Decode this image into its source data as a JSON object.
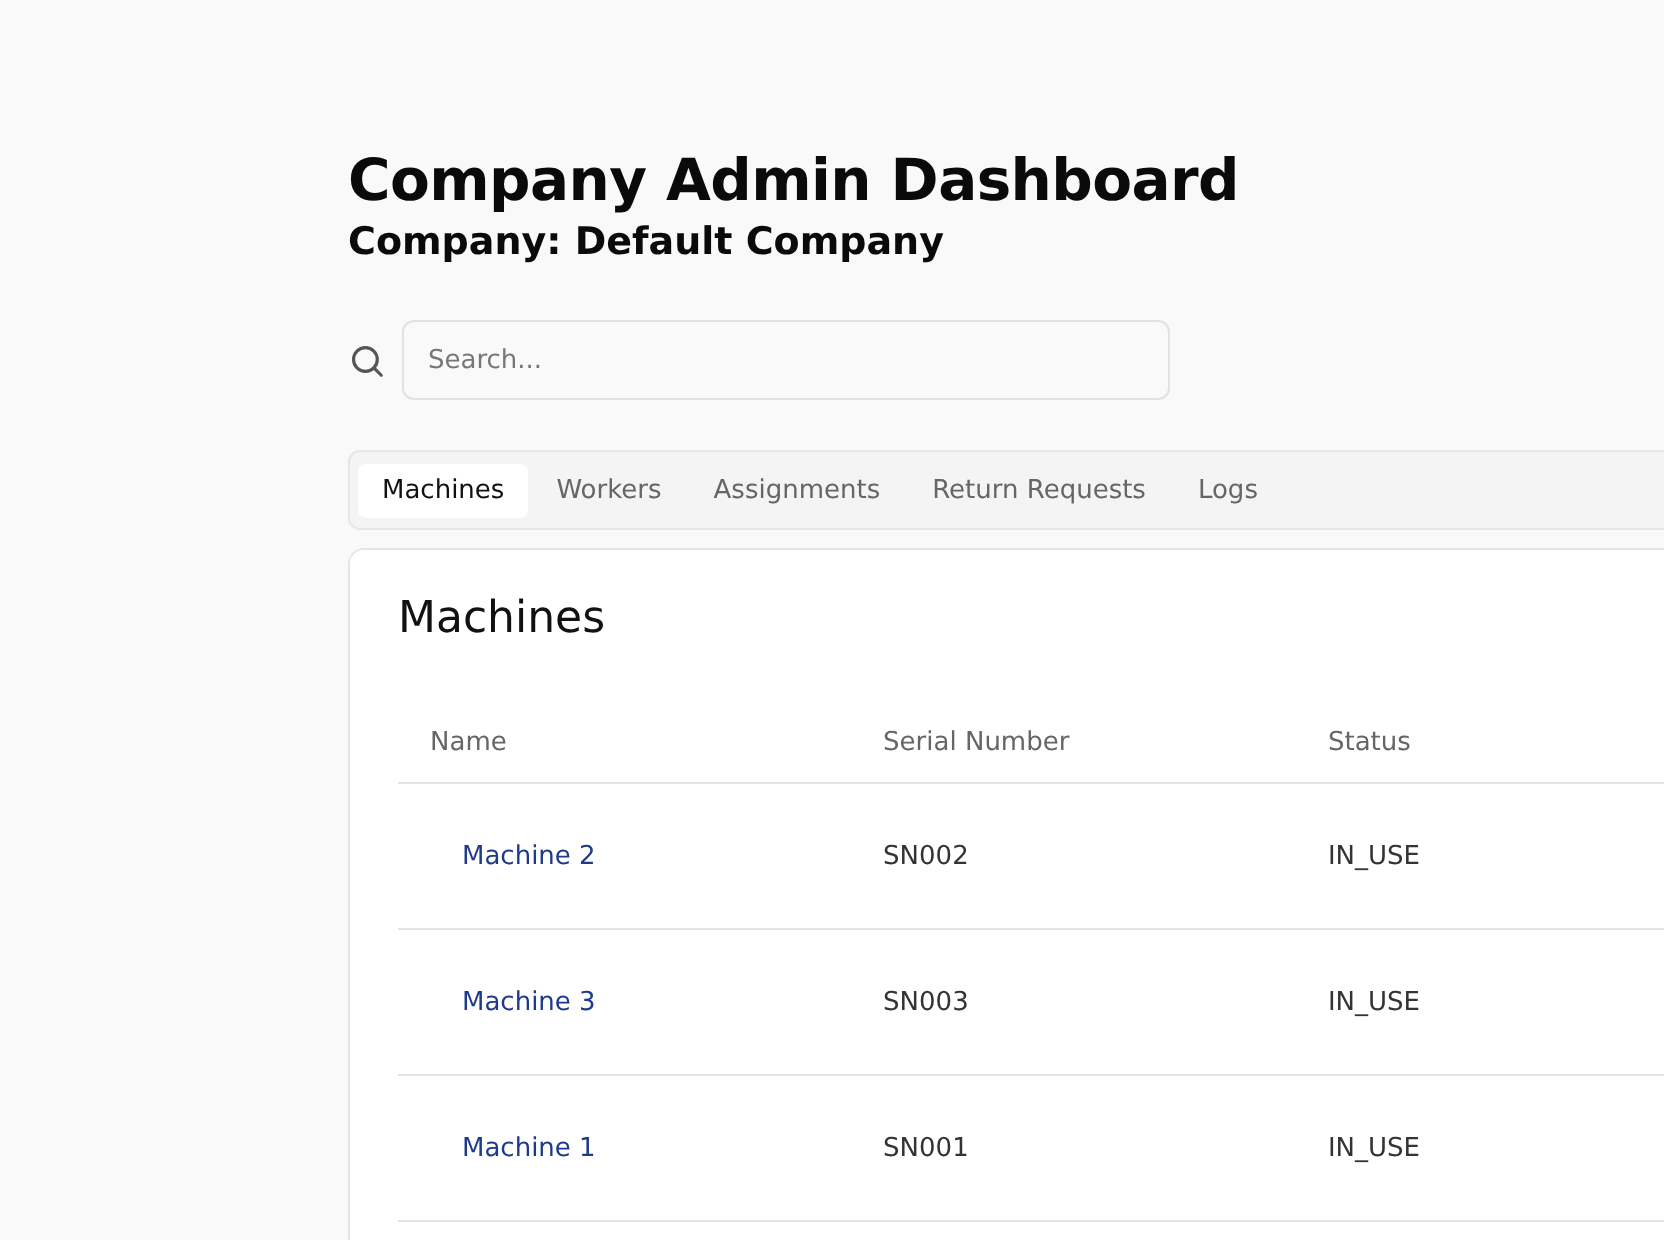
{
  "title": "Company Admin Dashboard",
  "subtitle": "Company: Default Company",
  "search": {
    "placeholder": "Search..."
  },
  "tabs": [
    {
      "label": "Machines",
      "selected": true
    },
    {
      "label": "Workers",
      "selected": false
    },
    {
      "label": "Assignments",
      "selected": false
    },
    {
      "label": "Return Requests",
      "selected": false
    },
    {
      "label": "Logs",
      "selected": false
    }
  ],
  "panel": {
    "title": "Machines",
    "table": {
      "columns": [
        "Name",
        "Serial Number",
        "Status"
      ],
      "rows": [
        [
          "Machine 2",
          "SN002",
          "IN_USE"
        ],
        [
          "Machine 3",
          "SN003",
          "IN_USE"
        ],
        [
          "Machine 1",
          "SN001",
          "IN_USE"
        ]
      ]
    }
  }
}
